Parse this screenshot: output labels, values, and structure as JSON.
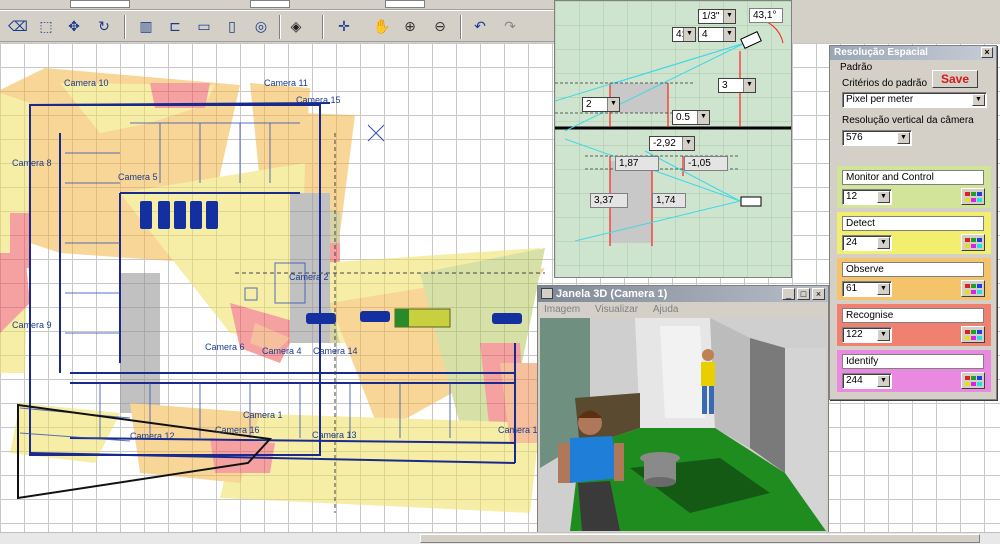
{
  "toolbar": {
    "tools": [
      {
        "icon": "eraser-icon",
        "glyph": "⌫"
      },
      {
        "icon": "select-icon",
        "glyph": "⬚"
      },
      {
        "icon": "move-icon",
        "glyph": "✥"
      },
      {
        "icon": "rotate-icon",
        "glyph": "↻"
      },
      {
        "icon": "wall-icon",
        "glyph": "▥"
      },
      {
        "icon": "room-icon",
        "glyph": "⊏"
      },
      {
        "icon": "window-icon",
        "glyph": "▭"
      },
      {
        "icon": "door-icon",
        "glyph": "▯"
      },
      {
        "icon": "column-icon",
        "glyph": "◎"
      },
      {
        "icon": "camera-3d-icon",
        "glyph": "◈"
      },
      {
        "icon": "pan-icon",
        "glyph": "✛"
      },
      {
        "icon": "hand-icon",
        "glyph": "✋"
      },
      {
        "icon": "zoom-in-icon",
        "glyph": "⊕"
      },
      {
        "icon": "zoom-out-icon",
        "glyph": "⊖"
      },
      {
        "icon": "undo-icon",
        "glyph": "↶"
      },
      {
        "icon": "redo-icon",
        "glyph": "↷"
      }
    ]
  },
  "plan": {
    "cameras": [
      "Camera 10",
      "Camera 11",
      "Camera 15",
      "Camera 8",
      "Camera 5",
      "Camera 9",
      "Camera 6",
      "Camera 4",
      "Camera 14",
      "Camera 1",
      "Camera 12",
      "Camera 16",
      "Camera 13",
      "Camera 1",
      "Camera 2"
    ]
  },
  "lens": {
    "sensor": "1/3\"",
    "angle": "43,1°",
    "ratio_a": "4:",
    "ratio_b": "4",
    "height": "3",
    "left_val": "2",
    "small_val": "0.5",
    "offset": "-2,92",
    "d1": "1,87",
    "d2": "-1,05",
    "d3": "3,37",
    "d4": "1,74"
  },
  "resolution_panel": {
    "title": "Resolução Espacial",
    "pattern_label": "Padrão",
    "criteria_label": "Critérios do padrão",
    "save_label": "Save",
    "criteria_value": "Pixel per meter",
    "vres_label": "Resolução vertical da câmera",
    "vres_value": "576",
    "bands": [
      {
        "name": "Monitor and Control",
        "value": "12",
        "color": "#d2e49a"
      },
      {
        "name": "Detect",
        "value": "24",
        "color": "#f2ef6e"
      },
      {
        "name": "Observe",
        "value": "61",
        "color": "#f5c46a"
      },
      {
        "name": "Recognise",
        "value": "122",
        "color": "#f08070"
      },
      {
        "name": "Identify",
        "value": "244",
        "color": "#e98ae0"
      }
    ]
  },
  "window3d": {
    "title": "Janela 3D (Camera 1)",
    "menu": [
      "Imagem",
      "Visualizar",
      "Ajuda"
    ],
    "min": "_",
    "max": "□",
    "close": "×"
  }
}
